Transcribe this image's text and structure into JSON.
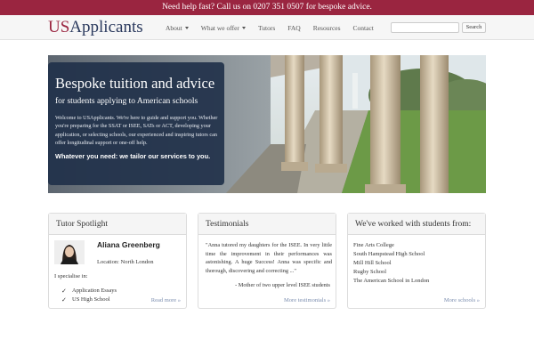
{
  "topbar": {
    "text": "Need help fast? Call us on 0207 351 0507 for bespoke advice."
  },
  "brand": {
    "part1": "US",
    "part2": "Applicants"
  },
  "nav": {
    "items": [
      {
        "label": "About",
        "dropdown": true
      },
      {
        "label": "What we offer",
        "dropdown": true
      },
      {
        "label": "Tutors",
        "dropdown": false
      },
      {
        "label": "FAQ",
        "dropdown": false
      },
      {
        "label": "Resources",
        "dropdown": false
      },
      {
        "label": "Contact",
        "dropdown": false
      }
    ],
    "search_value": "",
    "search_button": "Search"
  },
  "hero": {
    "title": "Bespoke tuition and advice",
    "subtitle": "for students applying to American schools",
    "text": "Welcome to USApplicants. We're here to guide and support you. Whether you're preparing for the SSAT or ISEE, SATs or ACT, developing your application, or selecting schools, our experienced and inspiring tutors can offer longitudinal support or one-off help.",
    "bold": "Whatever you need: we tailor our services to you."
  },
  "spotlight": {
    "title": "Tutor Spotlight",
    "name": "Aliana Greenberg",
    "location": "Location: North London",
    "specialise": "I specialise in:",
    "items": [
      "Application Essays",
      "US High School"
    ],
    "link": "Read more »"
  },
  "testimonials": {
    "title": "Testimonials",
    "quote": "\"Anna tutored my daughters for the ISEE. In very little time the improvement in their performances was astonishing. A huge Success! Anna was specific and thorough, discovering and correcting ...\"",
    "author": "- Mother of two upper level ISEE students",
    "link": "More testimonials »"
  },
  "schools": {
    "title": "We've worked with students from:",
    "items": [
      "Fine Arts College",
      "South Hampstead High School",
      "Mill Hill School",
      "Rugby School",
      "The American School in London"
    ],
    "link": "More schools »"
  },
  "colors": {
    "accent": "#9a2540",
    "brand_dark": "#2b3a5e",
    "hero_box": "#21314a",
    "link": "#7d8fb0"
  }
}
